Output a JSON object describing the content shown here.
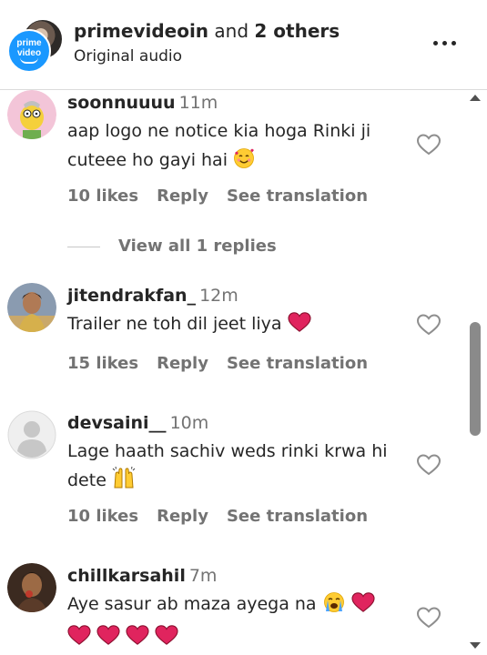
{
  "header": {
    "account_name": "primevideoin",
    "others_text": "and",
    "others_count": "2 others",
    "subtitle": "Original audio",
    "logo_line1": "prime",
    "logo_line2": "video"
  },
  "comments": [
    {
      "username": "soonnuuuu",
      "time": "11m",
      "text": "aap logo ne notice kia hoga Rinki ji cuteee ho gayi hai",
      "emoji_names": [
        "smiling-face-with-hearts-icon"
      ],
      "likes": "10 likes",
      "reply_label": "Reply",
      "translate_label": "See translation",
      "view_replies": "View all 1 replies"
    },
    {
      "username": "jitendrakfan_",
      "time": "12m",
      "text": "Trailer ne toh dil jeet liya",
      "emoji_names": [
        "red-heart-icon"
      ],
      "likes": "15 likes",
      "reply_label": "Reply",
      "translate_label": "See translation"
    },
    {
      "username": "devsaini__",
      "time": "10m",
      "text": "Lage haath sachiv weds rinki krwa hi dete",
      "emoji_names": [
        "raising-hands-icon"
      ],
      "likes": "10 likes",
      "reply_label": "Reply",
      "translate_label": "See translation"
    },
    {
      "username": "chillkarsahil",
      "time": "7m",
      "text": "Aye sasur ab maza ayega na",
      "emoji_names": [
        "loudly-crying-face-icon",
        "red-heart-icon",
        "red-heart-icon",
        "red-heart-icon",
        "red-heart-icon",
        "red-heart-icon"
      ]
    }
  ],
  "colors": {
    "primary_text": "#262626",
    "secondary_text": "#737373",
    "prime_blue": "#1a98ff",
    "heart_red": "#e0245e"
  }
}
